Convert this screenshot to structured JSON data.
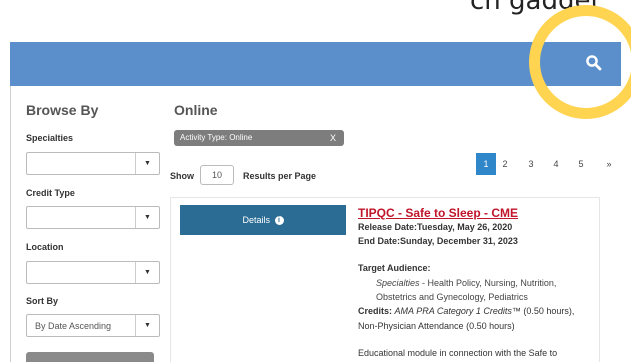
{
  "top_text": "ch gadget",
  "header": {
    "search_icon": "search-icon"
  },
  "sidebar": {
    "title": "Browse By",
    "specialties": {
      "label": "Specialties",
      "value": ""
    },
    "credit_type": {
      "label": "Credit Type",
      "value": ""
    },
    "location": {
      "label": "Location",
      "value": ""
    },
    "sort_by": {
      "label": "Sort By",
      "value": "By Date Ascending"
    }
  },
  "main": {
    "title": "Online",
    "filter_chip": {
      "label": "Activity Type: Online",
      "remove": "X"
    },
    "show_label": "Show",
    "per_page": "10",
    "results_per_page_label": "Results per Page",
    "pagination": [
      "1",
      "2",
      "3",
      "4",
      "5",
      "»"
    ],
    "active_page": "1",
    "result": {
      "details_label": "Details",
      "title": "TIPQC - Safe to Sleep - CME",
      "release_label": "Release Date:",
      "release_value": "Tuesday, May 26, 2020",
      "end_label": "End Date:",
      "end_value": "Sunday, December 31, 2023",
      "target_label": "Target Audience:",
      "specialties_label": "Specialties",
      "specialties_line1": " - Health Policy, Nursing, Nutrition,",
      "specialties_line2": "Obstetrics and Gynecology, Pediatrics",
      "credits_label": "Credits:",
      "credits_italic": "AMA PRA Category 1 Credits™",
      "credits_value": " (0.50 hours),",
      "credits_line2": "Non-Physician Attendance (0.50 hours)",
      "description": "Educational module in connection with the Safe to"
    }
  },
  "colors": {
    "header": "#5b8fcc",
    "highlight": "#ffd451",
    "details_button": "#2b6c94",
    "pagination_active": "#2f86c9",
    "title_link": "#c0152a",
    "chip": "#7d7d7d"
  }
}
